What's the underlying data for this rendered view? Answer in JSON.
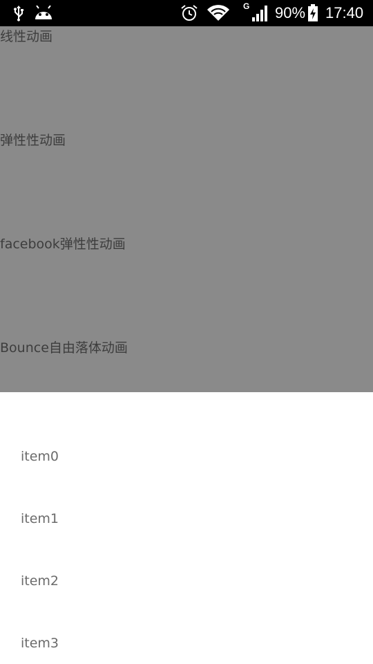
{
  "status_bar": {
    "battery_percent": "90%",
    "time": "17:40",
    "network_type": "G",
    "icons": [
      "usb-icon",
      "android-debug-icon",
      "alarm-icon",
      "wifi-icon",
      "signal-icon",
      "battery-charging-icon"
    ]
  },
  "panel": {
    "background": "#8a8a8a",
    "items": [
      {
        "label": "线性动画"
      },
      {
        "label": "弹性性动画"
      },
      {
        "label": "facebook弹性性动画"
      },
      {
        "label": "Bounce自由落体动画"
      }
    ]
  },
  "list": {
    "items": [
      {
        "label": "item0"
      },
      {
        "label": "item1"
      },
      {
        "label": "item2"
      },
      {
        "label": "item3"
      }
    ]
  }
}
